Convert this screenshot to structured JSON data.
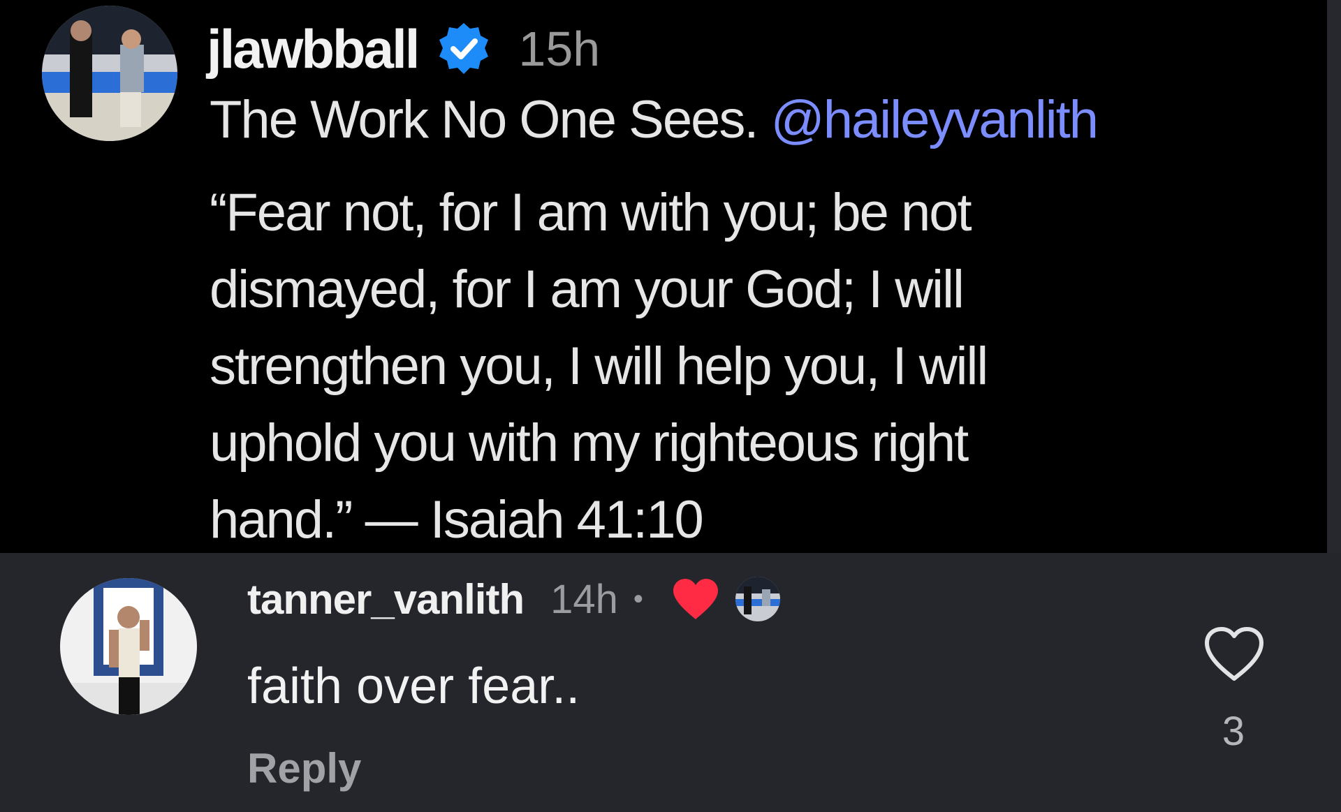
{
  "post": {
    "username": "jlawbball",
    "time": "15h",
    "title": "The Work No One Sees.",
    "mention": "@haileyvanlith",
    "body_lines": [
      "“Fear not, for I am with you; be not",
      "dismayed, for I am your God; I will",
      "strengthen you, I will help you, I will",
      "uphold you with my righteous right",
      "hand.” — Isaiah 41:10"
    ]
  },
  "comment": {
    "username": "tanner_vanlith",
    "time": "14h",
    "separator": "•",
    "text": "faith over fear..",
    "reply_label": "Reply",
    "like_count": "3"
  },
  "icons": {
    "verified": "verified-badge-icon",
    "author_liked": "red-heart-icon",
    "like": "heart-outline-icon"
  },
  "colors": {
    "post_background": "#000000",
    "comment_background": "#24262b",
    "mention": "#7b8dff",
    "verified": "#1d8cf8",
    "liked_heart": "#ff2b45"
  }
}
